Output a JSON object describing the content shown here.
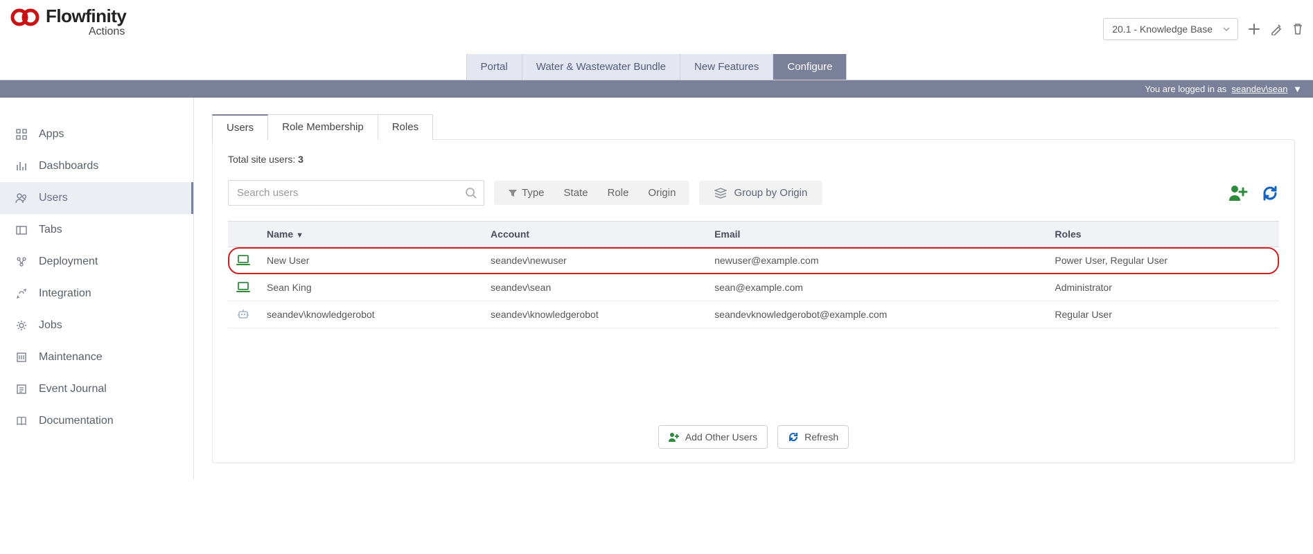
{
  "brand": {
    "name": "Flowfinity",
    "sub": "Actions"
  },
  "header": {
    "kb_label": "20.1 - Knowledge Base"
  },
  "navtabs": [
    "Portal",
    "Water & Wastewater Bundle",
    "New Features",
    "Configure"
  ],
  "nav_active_index": 3,
  "loginbar": {
    "prefix": "You are logged in as",
    "user": "seandev\\sean"
  },
  "sidebar": {
    "items": [
      {
        "label": "Apps",
        "icon": "grid-icon"
      },
      {
        "label": "Dashboards",
        "icon": "chart-icon"
      },
      {
        "label": "Users",
        "icon": "users-icon"
      },
      {
        "label": "Tabs",
        "icon": "tabs-icon"
      },
      {
        "label": "Deployment",
        "icon": "deploy-icon"
      },
      {
        "label": "Integration",
        "icon": "integration-icon"
      },
      {
        "label": "Jobs",
        "icon": "gear-icon"
      },
      {
        "label": "Maintenance",
        "icon": "maintenance-icon"
      },
      {
        "label": "Event Journal",
        "icon": "journal-icon"
      },
      {
        "label": "Documentation",
        "icon": "book-icon"
      }
    ],
    "active_index": 2
  },
  "subtabs": [
    "Users",
    "Role Membership",
    "Roles"
  ],
  "subtab_active_index": 0,
  "total": {
    "label": "Total site users:",
    "count": "3"
  },
  "search": {
    "placeholder": "Search users"
  },
  "filters": {
    "type": "Type",
    "state": "State",
    "role": "Role",
    "origin": "Origin"
  },
  "groupby": {
    "label": "Group by Origin"
  },
  "columns": {
    "name": "Name",
    "account": "Account",
    "email": "Email",
    "roles": "Roles"
  },
  "rows": [
    {
      "icon": "laptop-icon",
      "icon_color": "#2e8b3d",
      "name": "New User",
      "account": "seandev\\newuser",
      "email": "newuser@example.com",
      "roles": "Power User, Regular User",
      "highlight": true
    },
    {
      "icon": "laptop-icon",
      "icon_color": "#2e8b3d",
      "name": "Sean King",
      "account": "seandev\\sean",
      "email": "sean@example.com",
      "roles": "Administrator",
      "highlight": false
    },
    {
      "icon": "robot-icon",
      "icon_color": "#9fb7c3",
      "name": "seandev\\knowledgerobot",
      "account": "seandev\\knowledgerobot",
      "email": "seandevknowledgerobot@example.com",
      "roles": "Regular User",
      "highlight": false
    }
  ],
  "buttons": {
    "add_other": "Add Other Users",
    "refresh": "Refresh"
  }
}
